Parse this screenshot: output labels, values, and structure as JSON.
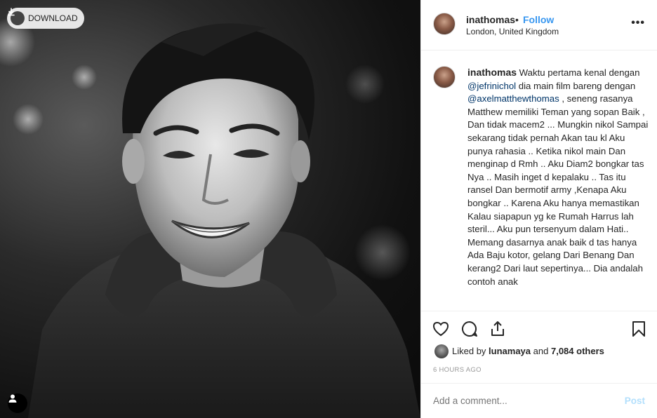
{
  "photo": {
    "download_label": "DOWNLOAD",
    "download_icon": "download-icon",
    "user_tag_icon": "person-icon"
  },
  "header": {
    "username": "inathomas",
    "separator": "•",
    "follow_label": "Follow",
    "location": "London, United Kingdom",
    "more_label": "•••"
  },
  "caption": {
    "username": "inathomas",
    "parts": [
      {
        "text": " Waktu pertama kenal dengan ",
        "mention": false
      },
      {
        "text": "@jefrinichol",
        "mention": true
      },
      {
        "text": " dia main film bareng dengan ",
        "mention": false
      },
      {
        "text": "@axelmatthewthomas",
        "mention": true
      },
      {
        "text": " , seneng rasanya Matthew memiliki Teman yang sopan Baik , Dan tidak macem2 ... Mungkin nikol Sampai sekarang tidak pernah Akan tau kl Aku punya rahasia .. Ketika nikol main Dan menginap d Rmh .. Aku Diam2 bongkar tas Nya .. Masih inget d kepalaku .. Tas itu ransel Dan bermotif army ,Kenapa Aku bongkar .. Karena Aku hanya memastikan Kalau siapapun yg ke Rumah Harrus lah steril... Aku pun tersenyum dalam Hati.. Memang dasarnya anak baik d tas hanya Ada Baju kotor, gelang Dari Benang Dan kerang2 Dari laut sepertinya... Dia andalah contoh anak",
        "mention": false
      }
    ]
  },
  "actions": {
    "icons": [
      "heart-icon",
      "comment-icon",
      "share-icon",
      "bookmark-icon"
    ],
    "liked_by_prefix": "Liked by",
    "liked_by_user": "lunamaya",
    "liked_by_and": "and",
    "liked_by_others": "7,084 others",
    "timestamp": "6 HOURS AGO"
  },
  "comment": {
    "placeholder": "Add a comment...",
    "post_label": "Post"
  },
  "colors": {
    "link_blue": "#3897f0",
    "mention": "#003569",
    "post_disabled": "#b2dffc",
    "border": "#efefef"
  }
}
